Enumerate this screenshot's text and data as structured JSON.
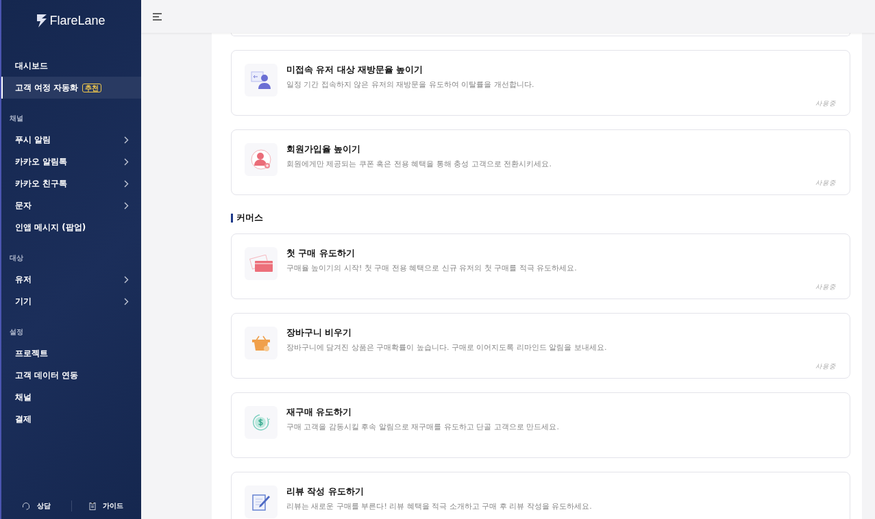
{
  "sidebar": {
    "logo": "FlareLane",
    "sections": [
      {
        "items": [
          {
            "label": "대시보드",
            "selected": false,
            "expandable": false
          },
          {
            "label": "고객 여정 자동화",
            "badge": "추천",
            "selected": true,
            "expandable": false
          }
        ]
      },
      {
        "title": "채널",
        "items": [
          {
            "label": "푸시 알림",
            "selected": false,
            "expandable": true
          },
          {
            "label": "카카오 알림톡",
            "selected": false,
            "expandable": true
          },
          {
            "label": "카카오 친구톡",
            "selected": false,
            "expandable": true
          },
          {
            "label": "문자",
            "selected": false,
            "expandable": true
          },
          {
            "label": "인앱 메시지 (팝업)",
            "selected": false,
            "expandable": false
          }
        ]
      },
      {
        "title": "대상",
        "items": [
          {
            "label": "유저",
            "selected": false,
            "expandable": true
          },
          {
            "label": "기기",
            "selected": false,
            "expandable": true
          }
        ]
      },
      {
        "title": "설정",
        "items": [
          {
            "label": "프로젝트",
            "selected": false,
            "expandable": false
          },
          {
            "label": "고객 데이터 연동",
            "selected": false,
            "expandable": false
          },
          {
            "label": "채널",
            "selected": false,
            "expandable": false
          },
          {
            "label": "결제",
            "selected": false,
            "expandable": false
          }
        ]
      }
    ],
    "footer": [
      {
        "kind": "headset",
        "label": "상담"
      },
      {
        "kind": "document",
        "label": "가이드"
      }
    ]
  },
  "content": {
    "blocks": [
      {
        "kind": "card",
        "title": "미접속 유저 대상 재방문율 높이기",
        "description": "일정 기간 접속하지 않은 유저의 재방문을 유도하여 이탈률을 개선합니다.",
        "status": "사용중"
      },
      {
        "kind": "card",
        "title": "회원가입율 높이기",
        "description": "회원에게만 제공되는 쿠폰 혹은 전용 혜택을 통해 충성 고객으로 전환시키세요.",
        "status": "사용중"
      },
      {
        "kind": "heading",
        "title": "커머스"
      },
      {
        "kind": "card",
        "title": "첫 구매 유도하기",
        "description": "구매율 높이기의 시작! 첫 구매 전용 혜택으로 신규 유저의 첫 구매를 적극 유도하세요.",
        "status": "사용중"
      },
      {
        "kind": "card",
        "title": "장바구니 비우기",
        "description": "장바구니에 담겨진 상품은 구매확률이 높습니다. 구매로 이어지도록 리마인드 알림을 보내세요.",
        "status": "사용중"
      },
      {
        "kind": "card",
        "title": "재구매 유도하기",
        "description": "구매 고객을 감동시킬 후속 알림으로 재구매를 유도하고 단골 고객으로 만드세요."
      },
      {
        "kind": "card",
        "title": "리뷰 작성 유도하기",
        "description": "리뷰는 새로운 구매를 부른다! 리뷰 혜택을 적극 소개하고 구매 후 리뷰 작성을 유도하세요."
      }
    ]
  }
}
